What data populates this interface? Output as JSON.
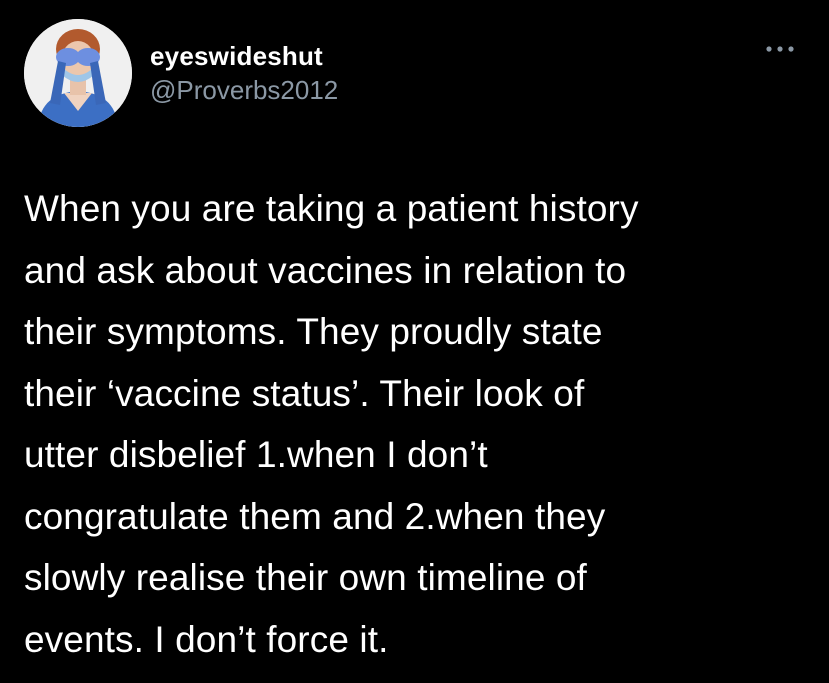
{
  "author": {
    "display_name": "eyeswideshut",
    "handle": "@Proverbs2012",
    "avatar_icon": "person-covering-eyes-avatar"
  },
  "actions": {
    "more_icon": "ellipsis-icon"
  },
  "tweet": {
    "text": "When you are taking a patient history\nand ask about vaccines in relation to\ntheir symptoms. They proudly state\ntheir ‘vaccine status’. Their look of\nutter disbelief 1.when I don’t\ncongratulate them and 2.when they\nslowly realise their own timeline of\nevents. I don’t force it."
  },
  "colors": {
    "background": "#000000",
    "primary_text": "#ffffff",
    "secondary_text": "#8b98a5"
  }
}
